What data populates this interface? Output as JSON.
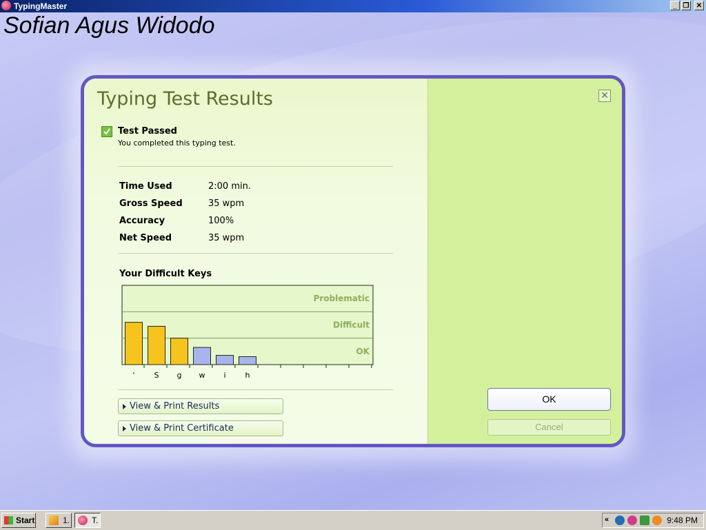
{
  "window": {
    "title": "TypingMaster",
    "minimize_label": "_",
    "restore_label": "❐",
    "close_label": "✕"
  },
  "desktop": {
    "user_name": "Sofian Agus Widodo"
  },
  "dialog": {
    "title": "Typing Test Results",
    "close_label": "✕",
    "status": {
      "title": "Test Passed",
      "subtitle": "You completed this typing test.",
      "checked": true
    },
    "stats": [
      {
        "label": "Time Used",
        "value": "2:00 min."
      },
      {
        "label": "Gross Speed",
        "value": "35 wpm"
      },
      {
        "label": "Accuracy",
        "value": "100%"
      },
      {
        "label": "Net Speed",
        "value": "35 wpm"
      }
    ],
    "difficult_keys_title": "Your Difficult Keys",
    "links": {
      "view_results": "View & Print Results",
      "view_certificate": "View & Print Certificate"
    },
    "buttons": {
      "ok": "OK",
      "cancel": "Cancel"
    }
  },
  "chart_data": {
    "type": "bar",
    "categories": [
      "'",
      "S",
      "g",
      "w",
      "i",
      "h",
      "",
      "",
      "",
      "",
      ""
    ],
    "values": [
      1.6,
      1.45,
      1.0,
      0.65,
      0.35,
      0.3,
      0,
      0,
      0,
      0,
      0
    ],
    "band_labels": [
      "OK",
      "Difficult",
      "Problematic"
    ],
    "ylim": [
      0,
      3
    ],
    "colors": {
      "difficult": "#f7c41f",
      "ok": "#a8b4ee",
      "band_text": "#8fae5a",
      "grid": "#7f9a5a"
    },
    "thresholds": {
      "difficult_min": 1.0
    }
  },
  "taskbar": {
    "start_label": "Start",
    "tasks": [
      {
        "label": "1.",
        "icon": "paint-icon",
        "active": false
      },
      {
        "label": "T.",
        "icon": "typingmaster-icon",
        "active": true
      }
    ],
    "tray_chevron": "«",
    "tray_icons": [
      "c-icon",
      "s-icon",
      "network-icon",
      "avast-icon"
    ],
    "clock": "9:48 PM"
  }
}
